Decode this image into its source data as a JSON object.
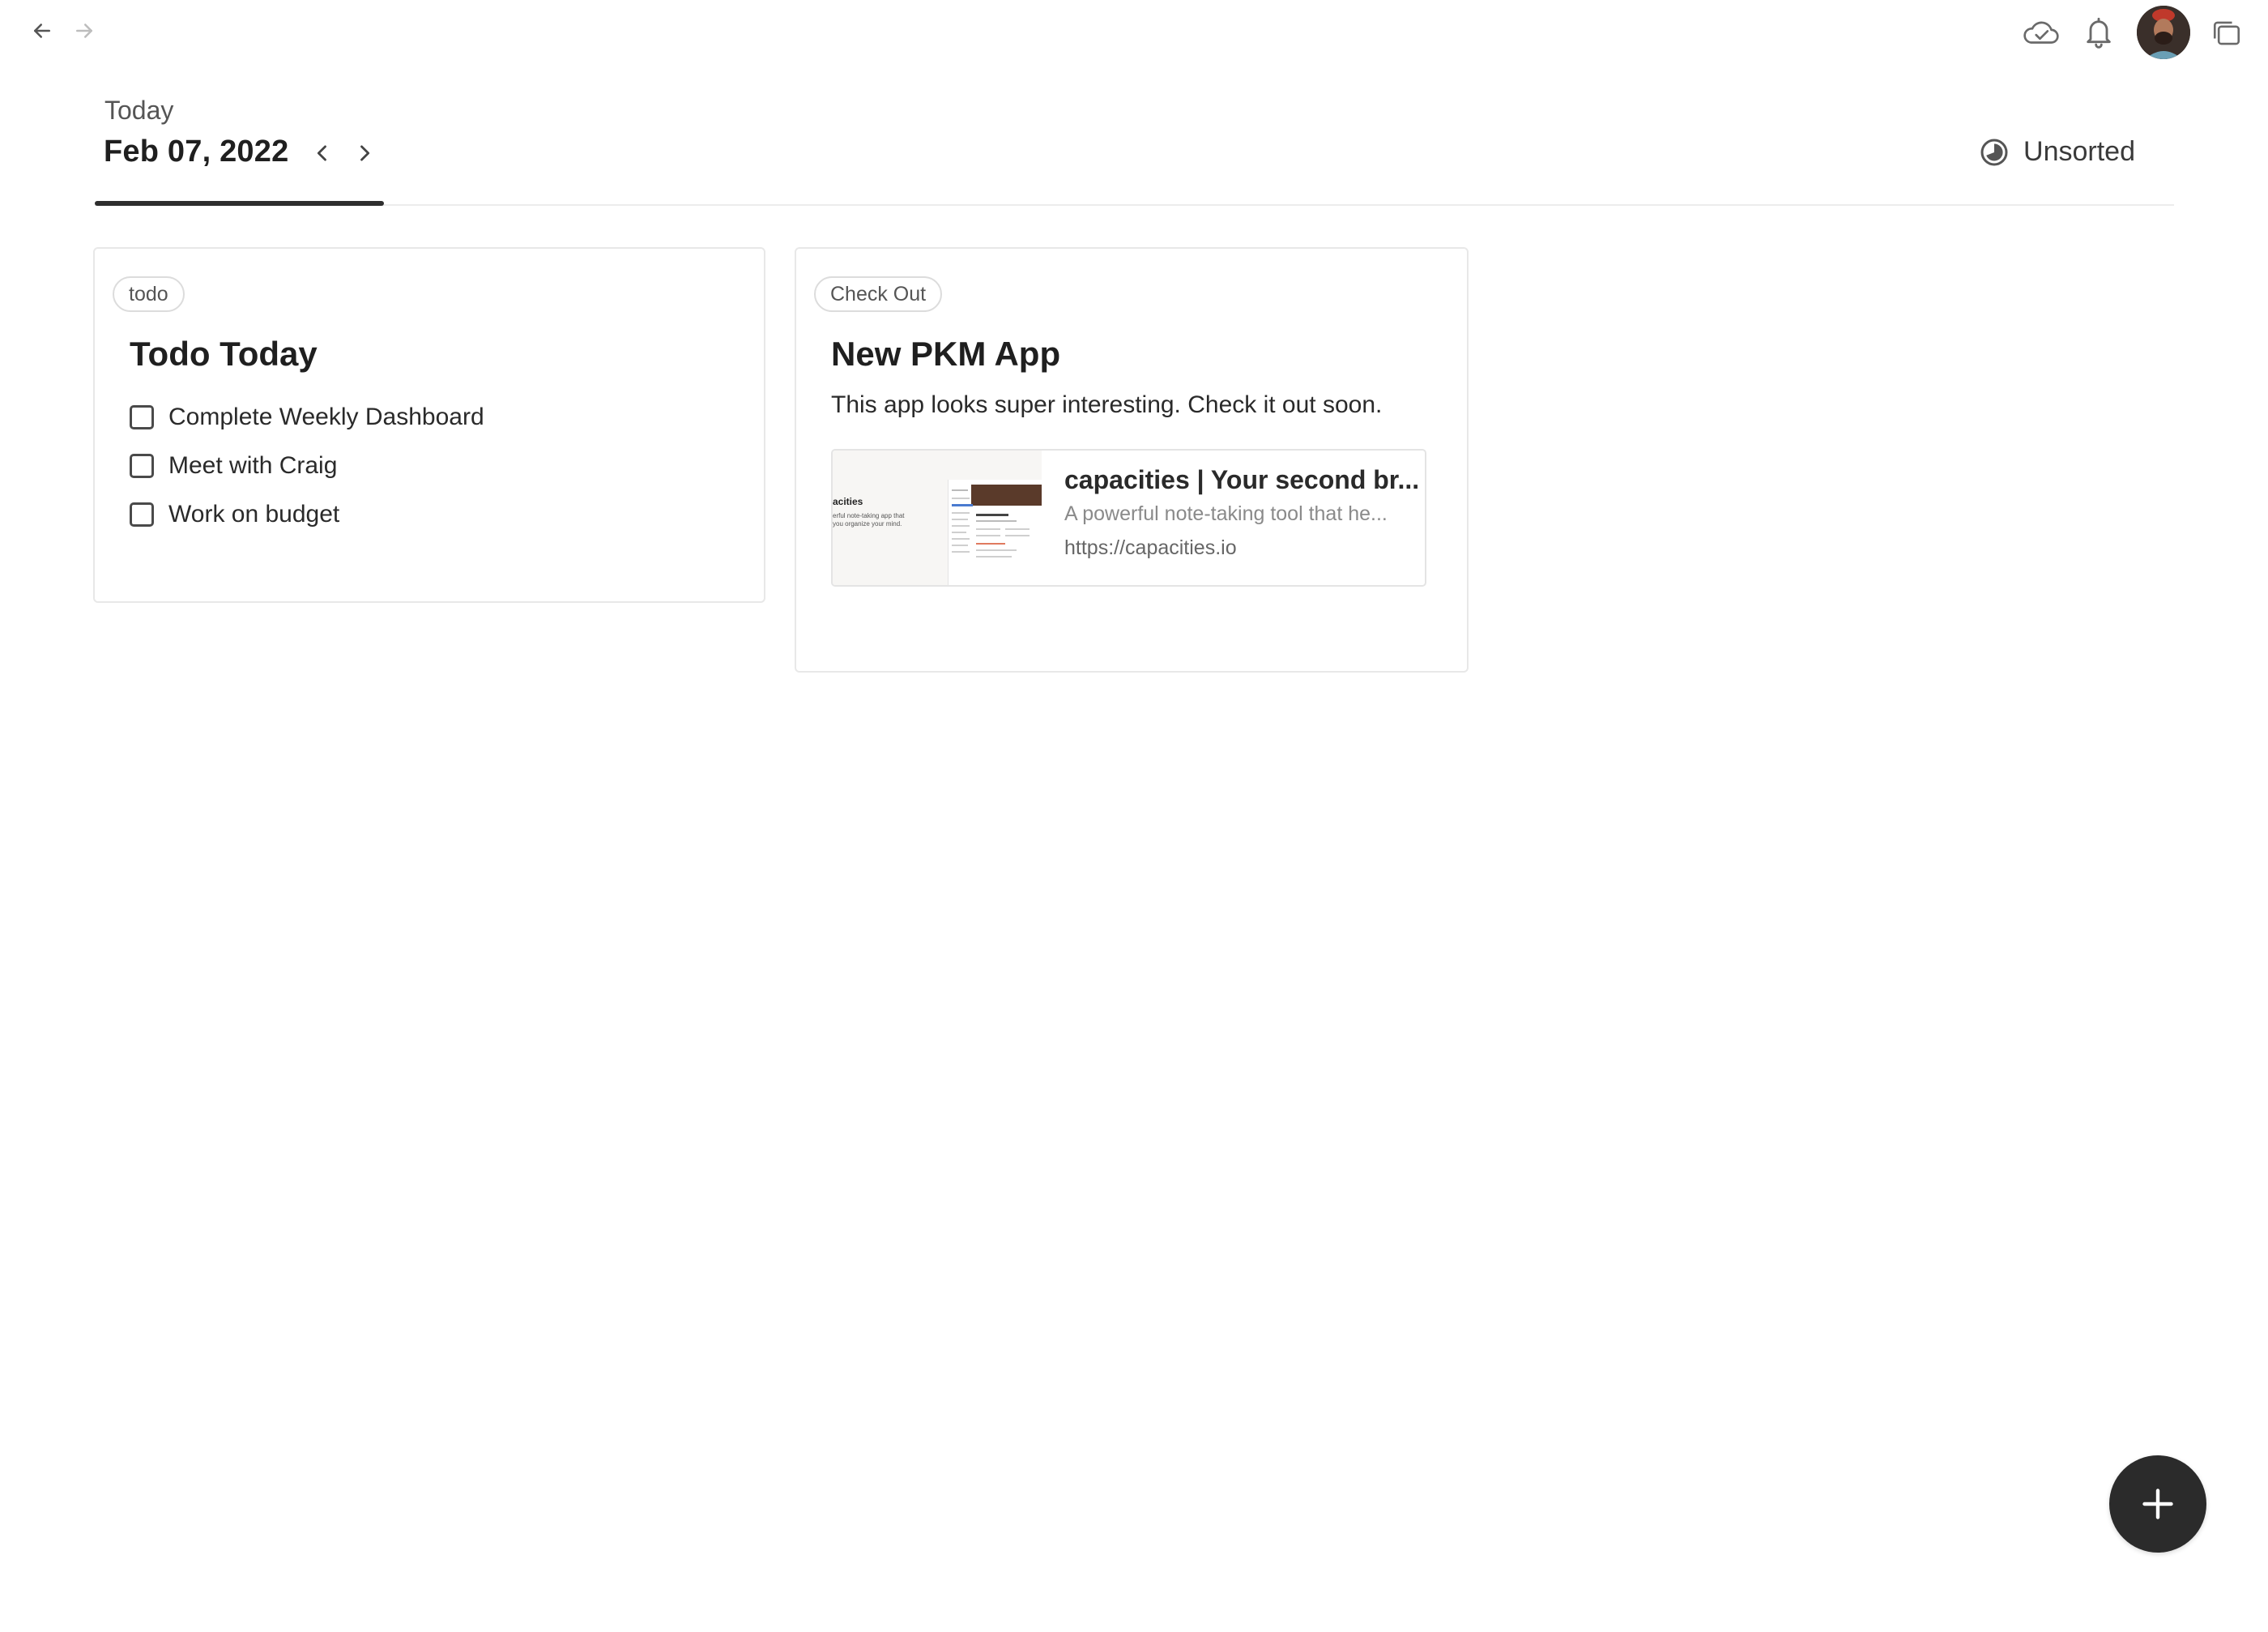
{
  "header": {
    "today_label": "Today",
    "date": "Feb 07, 2022",
    "sort_label": "Unsorted"
  },
  "cards": [
    {
      "tag": "todo",
      "title": "Todo Today",
      "todos": [
        {
          "text": "Complete Weekly Dashboard",
          "checked": false
        },
        {
          "text": "Meet with Craig",
          "checked": false
        },
        {
          "text": "Work on budget",
          "checked": false
        }
      ]
    },
    {
      "tag": "Check Out",
      "title": "New PKM App",
      "body": "This app looks super interesting. Check it out soon.",
      "link": {
        "title": "capacities | Your second br...",
        "description": "A powerful note-taking tool that he...",
        "url": "https://capacities.io",
        "thumb_text_1": "acities",
        "thumb_text_2": "erful note-taking app that",
        "thumb_text_3": "you organize your mind."
      }
    }
  ],
  "icons": {
    "back": "arrow-left-icon",
    "forward": "arrow-right-icon",
    "sync": "cloud-check-icon",
    "notifications": "bell-icon",
    "windows": "windows-icon",
    "sort": "pie-icon",
    "add": "plus-icon"
  },
  "colors": {
    "accent_dark": "#2b2b2b",
    "border": "#e8e8e8",
    "text": "#1f1f1f"
  }
}
